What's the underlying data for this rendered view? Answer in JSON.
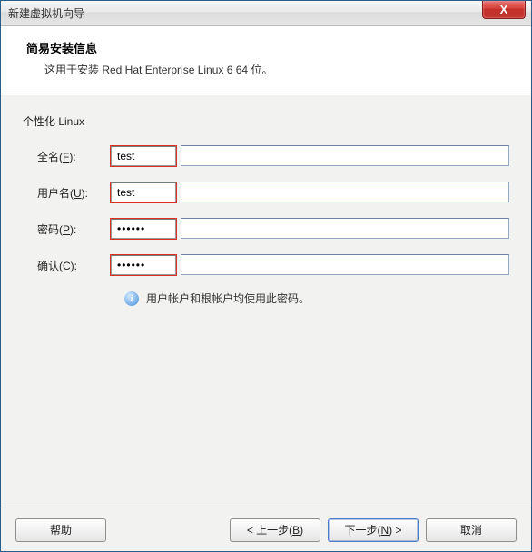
{
  "window": {
    "title": "新建虚拟机向导",
    "close": "X"
  },
  "header": {
    "title": "简易安装信息",
    "desc": "这用于安装 Red Hat Enterprise Linux 6 64 位。"
  },
  "section": {
    "title": "个性化 Linux"
  },
  "form": {
    "fullname": {
      "label_pre": "全名(",
      "key": "F",
      "label_post": "):",
      "value": "test"
    },
    "username": {
      "label_pre": "用户名(",
      "key": "U",
      "label_post": "):",
      "value": "test"
    },
    "password": {
      "label_pre": "密码(",
      "key": "P",
      "label_post": "):",
      "value": "••••••"
    },
    "confirm": {
      "label_pre": "确认(",
      "key": "C",
      "label_post": "):",
      "value": "••••••"
    }
  },
  "info": {
    "text": "用户帐户和根帐户均使用此密码。"
  },
  "buttons": {
    "help": "帮助",
    "back_pre": "< 上一步(",
    "back_key": "B",
    "back_post": ")",
    "next_pre": "下一步(",
    "next_key": "N",
    "next_post": ") >",
    "cancel": "取消"
  }
}
